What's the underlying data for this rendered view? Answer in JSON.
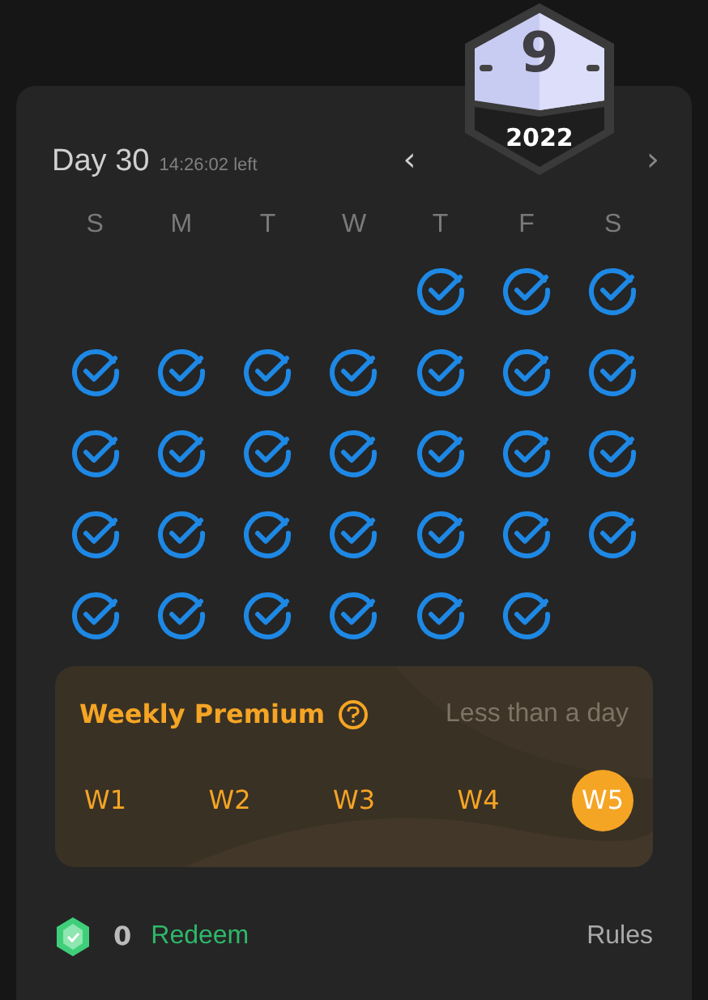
{
  "badge": {
    "number": "9",
    "year": "2022"
  },
  "header": {
    "title": "Day 30",
    "countdown": "14:26:02 left",
    "prev": "‹",
    "next": "›"
  },
  "weekdays": [
    "S",
    "M",
    "T",
    "W",
    "T",
    "F",
    "S"
  ],
  "calendar": [
    [
      {
        "kind": "blank"
      },
      {
        "kind": "blank"
      },
      {
        "kind": "blank"
      },
      {
        "kind": "blank"
      },
      {
        "kind": "day",
        "checked": true
      },
      {
        "kind": "day",
        "checked": true
      },
      {
        "kind": "day",
        "checked": true
      }
    ],
    [
      {
        "kind": "day",
        "checked": true
      },
      {
        "kind": "day",
        "checked": true
      },
      {
        "kind": "day",
        "checked": true
      },
      {
        "kind": "day",
        "checked": true
      },
      {
        "kind": "day",
        "checked": true
      },
      {
        "kind": "day",
        "checked": true
      },
      {
        "kind": "day",
        "checked": true
      }
    ],
    [
      {
        "kind": "day",
        "checked": true
      },
      {
        "kind": "day",
        "checked": true
      },
      {
        "kind": "day",
        "checked": true
      },
      {
        "kind": "day",
        "checked": true
      },
      {
        "kind": "day",
        "checked": true
      },
      {
        "kind": "day",
        "checked": true
      },
      {
        "kind": "day",
        "checked": true
      }
    ],
    [
      {
        "kind": "day",
        "checked": true
      },
      {
        "kind": "day",
        "checked": true
      },
      {
        "kind": "day",
        "checked": true
      },
      {
        "kind": "day",
        "checked": true
      },
      {
        "kind": "day",
        "checked": true
      },
      {
        "kind": "day",
        "checked": true
      },
      {
        "kind": "day",
        "checked": true
      }
    ],
    [
      {
        "kind": "day",
        "checked": true
      },
      {
        "kind": "day",
        "checked": true
      },
      {
        "kind": "day",
        "checked": true
      },
      {
        "kind": "day",
        "checked": true
      },
      {
        "kind": "day",
        "checked": true
      },
      {
        "kind": "day",
        "checked": true
      },
      {
        "kind": "blank"
      }
    ]
  ],
  "premium": {
    "title": "Weekly Premium",
    "remaining": "Less than a day",
    "weeks": [
      {
        "label": "W1",
        "selected": false
      },
      {
        "label": "W2",
        "selected": false
      },
      {
        "label": "W3",
        "selected": false
      },
      {
        "label": "W4",
        "selected": false
      },
      {
        "label": "W5",
        "selected": true
      }
    ]
  },
  "footer": {
    "points": "0",
    "redeem": "Redeem",
    "rules": "Rules"
  }
}
